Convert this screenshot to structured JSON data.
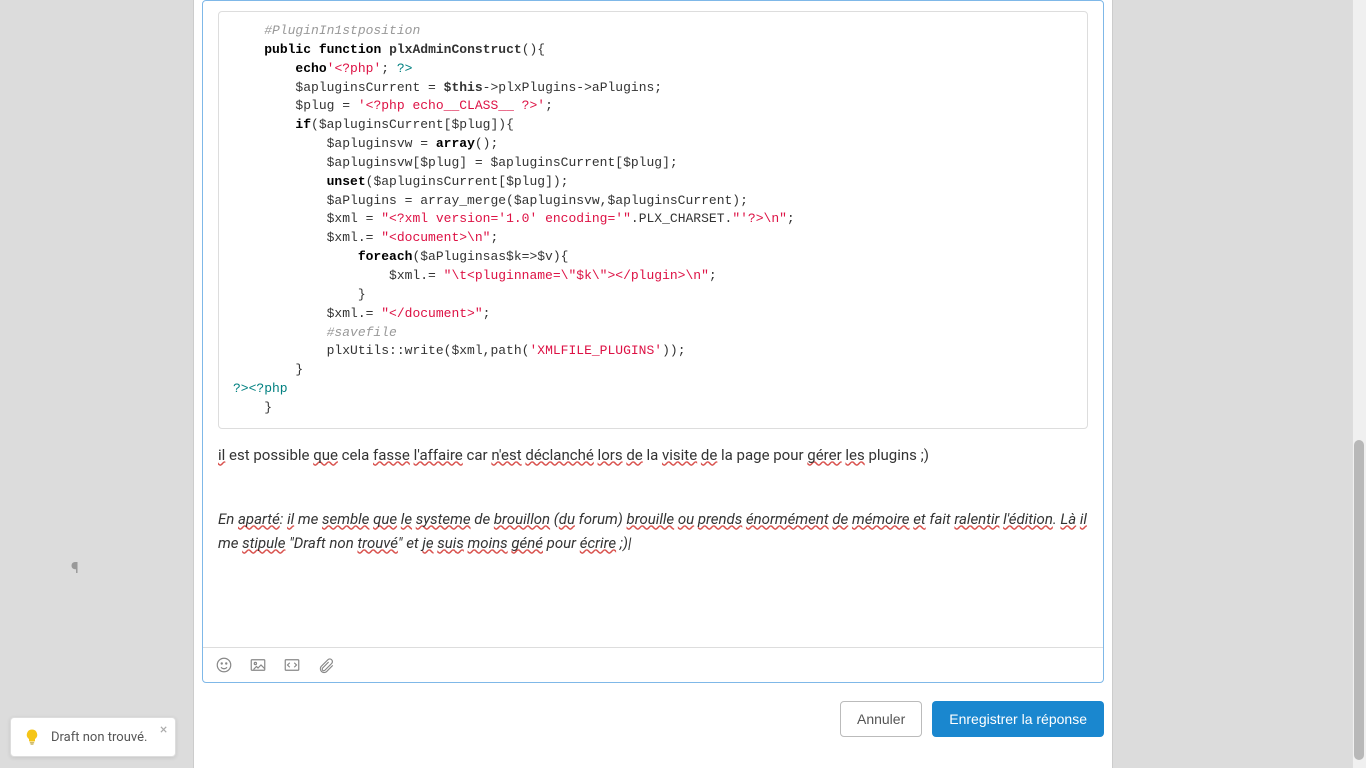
{
  "code": {
    "c1": "#PluginIn1stposition",
    "kw_public": "public",
    "kw_function": "function",
    "fn_name": "plxAdminConstruct",
    "paren_open": "(){",
    "kw_echo": "echo",
    "s_phpopen": "'<?php'",
    "s_phpclose": "?>",
    "v_apluginsCurrent": "$apluginsCurrent",
    "assign1": " = ",
    "kw_this": "$this",
    "arrow1": "->plxPlugins->aPlugins;",
    "v_plug": "$plug",
    "assign2": " = ",
    "s_classline": "'<?php echo__CLASS__ ?>'",
    "semi": ";",
    "kw_if": "if",
    "if_cond": "($apluginsCurrent[$plug]){",
    "v_apluginsvw": "$apluginsvw",
    "kw_array": "array",
    "array_call": "();",
    "line8": "$apluginsvw[$plug] = $apluginsCurrent[$plug];",
    "kw_unset": "unset",
    "unset_args": "($apluginsCurrent[$plug]);",
    "line10": "$aPlugins = array_merge($apluginsvw,$apluginsCurrent);",
    "v_xml": "$xml",
    "s_xmlhead1": "\"<?xml version='1.0' encoding='\"",
    "const_charset": ".PLX_CHARSET.",
    "s_xmlhead2": "\"'?>\\n\"",
    "xml_assign2": "$xml.= ",
    "s_docopen": "\"<document>\\n\"",
    "kw_foreach": "foreach",
    "foreach_args": "($aPluginsas$k=>$v){",
    "xml_assign3": "$xml.= ",
    "s_plugline": "\"\\t<pluginname=\\\"$k\\\"></plugin>\\n\"",
    "close_brace": "}",
    "xml_assign4": "$xml.= ",
    "s_docclose": "\"</document>\"",
    "c_savefile": "#savefile",
    "write_call_pre": "plxUtils::write($xml,path(",
    "s_xmlfile": "'XMLFILE_PLUGINS'",
    "write_call_post": "));",
    "close1": "}",
    "phpend": "?><?php",
    "close2": "}"
  },
  "body_para1_parts": {
    "p1": "il",
    "p2": " est possible ",
    "p3": "que",
    "p4": " cela ",
    "p5": "fasse",
    "p6": " ",
    "p7": "l'affaire",
    "p8": " car ",
    "p9": "n'est",
    "p10": " ",
    "p11": "déclanché",
    "p12": " ",
    "p13": "lors",
    "p14": " ",
    "p15": "de",
    "p16": " la ",
    "p17": "visite",
    "p18": " ",
    "p19": "de",
    "p20": " la page pour ",
    "p21": "gérer",
    "p22": " ",
    "p23": "les",
    "p24": " plugins ;)"
  },
  "body_para2_parts": {
    "p1": "En ",
    "p2": "aparté",
    "p3": ": ",
    "p4": "il",
    "p5": " me ",
    "p6": "semble",
    "p7": " ",
    "p8": "que",
    "p9": " ",
    "p10": "le",
    "p11": " ",
    "p12": "systeme",
    "p13": " de ",
    "p14": "brouillon",
    "p15": " (",
    "p16": "du",
    "p17": " forum) ",
    "p18": "brouille",
    "p19": " ",
    "p20": "ou",
    "p21": " ",
    "p22": "prends",
    "p23": " ",
    "p24": "énormément",
    "p25": " ",
    "p26": "de",
    "p27": " ",
    "p28": "mémoire",
    "p29": " ",
    "p30": "et",
    "p31": " fait ",
    "p32": "ralentir",
    "p33": " ",
    "p34": "l'édition",
    "p35": ". ",
    "p36": "Là",
    "p37": " ",
    "p38": "il",
    "p39": " me ",
    "p40": "stipule",
    "p41": " \"Draft non ",
    "p42": "trouvé",
    "p43": "\" et ",
    "p44": "je",
    "p45": " ",
    "p46": "suis",
    "p47": " ",
    "p48": "moins",
    "p49": " ",
    "p50": "géné",
    "p51": " pour ",
    "p52": "écrire",
    "p53": " ;)|"
  },
  "buttons": {
    "cancel": "Annuler",
    "submit": "Enregistrer la réponse"
  },
  "toast": {
    "text": "Draft non trouvé.",
    "close": "×"
  },
  "pilcrow": "¶"
}
